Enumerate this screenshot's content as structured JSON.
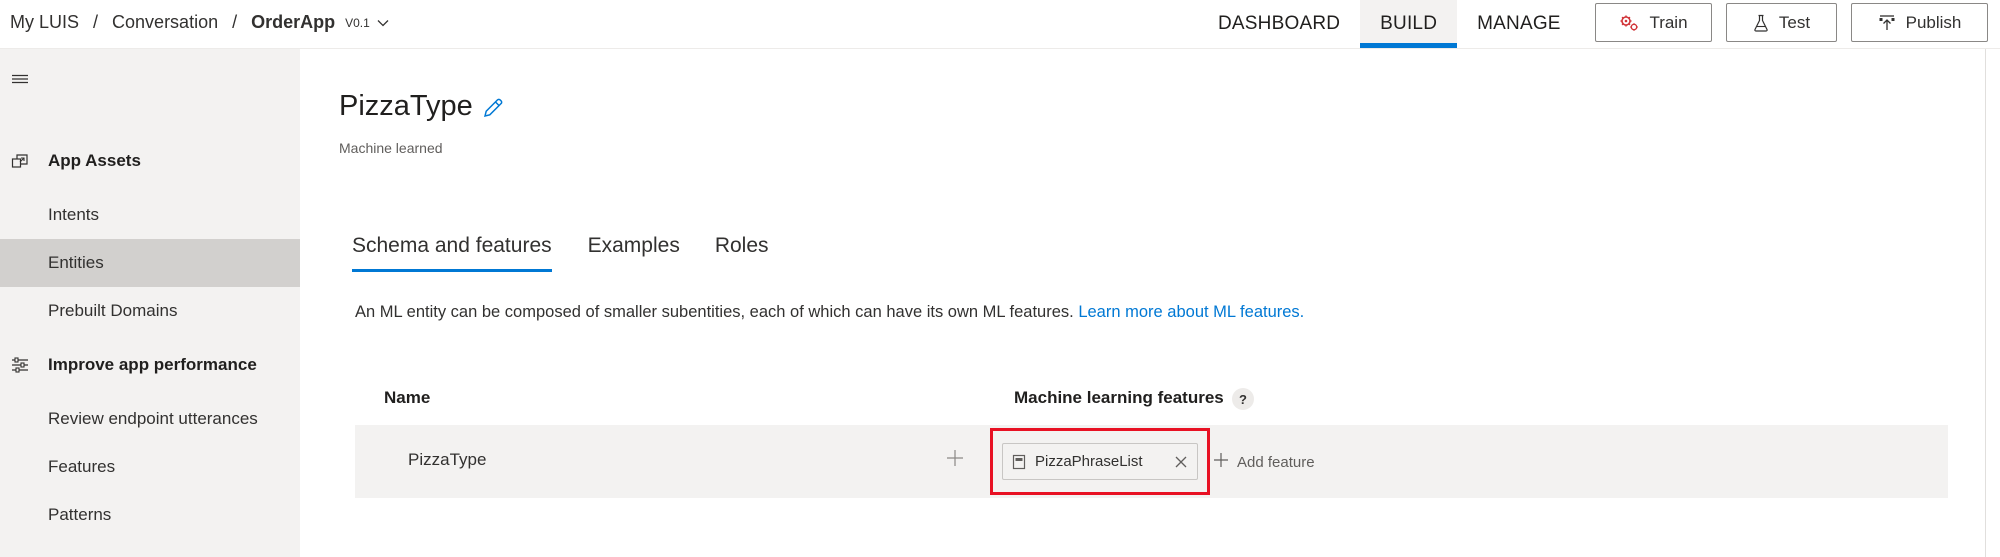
{
  "breadcrumb": {
    "root": "My LUIS",
    "separator": "/",
    "folder": "Conversation",
    "app_name": "OrderApp",
    "version": "V0.1"
  },
  "nav": {
    "tabs": [
      {
        "label": "DASHBOARD",
        "active": false
      },
      {
        "label": "BUILD",
        "active": true
      },
      {
        "label": "MANAGE",
        "active": false
      }
    ]
  },
  "toolbar": {
    "train_label": "Train",
    "test_label": "Test",
    "publish_label": "Publish"
  },
  "sidebar": {
    "groups": [
      {
        "label": "App Assets",
        "icon": "app-assets-icon"
      },
      {
        "label": "Improve app performance",
        "icon": "sliders-icon"
      }
    ],
    "items": [
      {
        "label": "Intents",
        "selected": false
      },
      {
        "label": "Entities",
        "selected": true
      },
      {
        "label": "Prebuilt Domains",
        "selected": false
      },
      {
        "label": "Review endpoint utterances",
        "selected": false
      },
      {
        "label": "Features",
        "selected": false
      },
      {
        "label": "Patterns",
        "selected": false
      }
    ]
  },
  "entity": {
    "name": "PizzaType",
    "type": "Machine learned"
  },
  "tabs": [
    {
      "label": "Schema and features",
      "active": true
    },
    {
      "label": "Examples",
      "active": false
    },
    {
      "label": "Roles",
      "active": false
    }
  ],
  "description": {
    "text": "An ML entity can be composed of smaller subentities, each of which can have its own ML features. ",
    "link": "Learn more about ML features."
  },
  "table": {
    "col_name": "Name",
    "col_features": "Machine learning features",
    "help_glyph": "?",
    "rows": [
      {
        "name": "PizzaType",
        "features": [
          "PizzaPhraseList"
        ]
      }
    ],
    "add_feature_label": "Add feature"
  },
  "colors": {
    "accent": "#0078d4",
    "highlight": "#e81123",
    "train_icon": "#d13438"
  }
}
